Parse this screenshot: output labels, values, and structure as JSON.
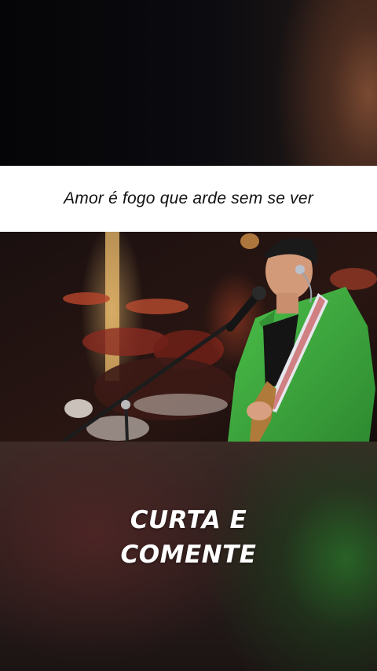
{
  "caption": {
    "lyric": "Amor é fogo que arde sem se ver"
  },
  "video": {
    "scene": "performer-singing-with-guitar"
  },
  "cta": {
    "line1": "CURTA E",
    "line2": "COMENTE"
  },
  "colors": {
    "caption_bg": "#ffffff",
    "caption_text": "#111111",
    "cta_text": "#ffffff",
    "jacket_green": "#3aa43a"
  }
}
